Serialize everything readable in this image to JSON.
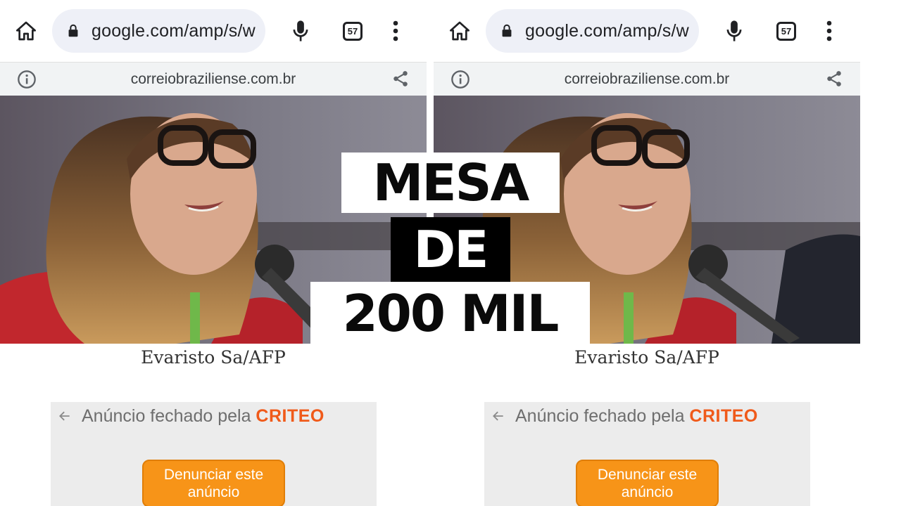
{
  "browser": {
    "url": "google.com/amp/s/w",
    "tab_count": "57",
    "amp_domain": "correiobraziliense.com.br"
  },
  "article": {
    "photo_caption": "Evaristo Sa/AFP"
  },
  "ad": {
    "closed_text": "Anúncio fechado pela",
    "brand": "CRITEO",
    "report_button": "Denunciar este anúncio"
  },
  "headline": {
    "line1": "MESA",
    "line2": "DE",
    "line3": "200 MIL"
  },
  "colors": {
    "criteo_orange": "#f05a1a",
    "button_orange": "#f79418",
    "url_pill": "#eef0f7"
  }
}
